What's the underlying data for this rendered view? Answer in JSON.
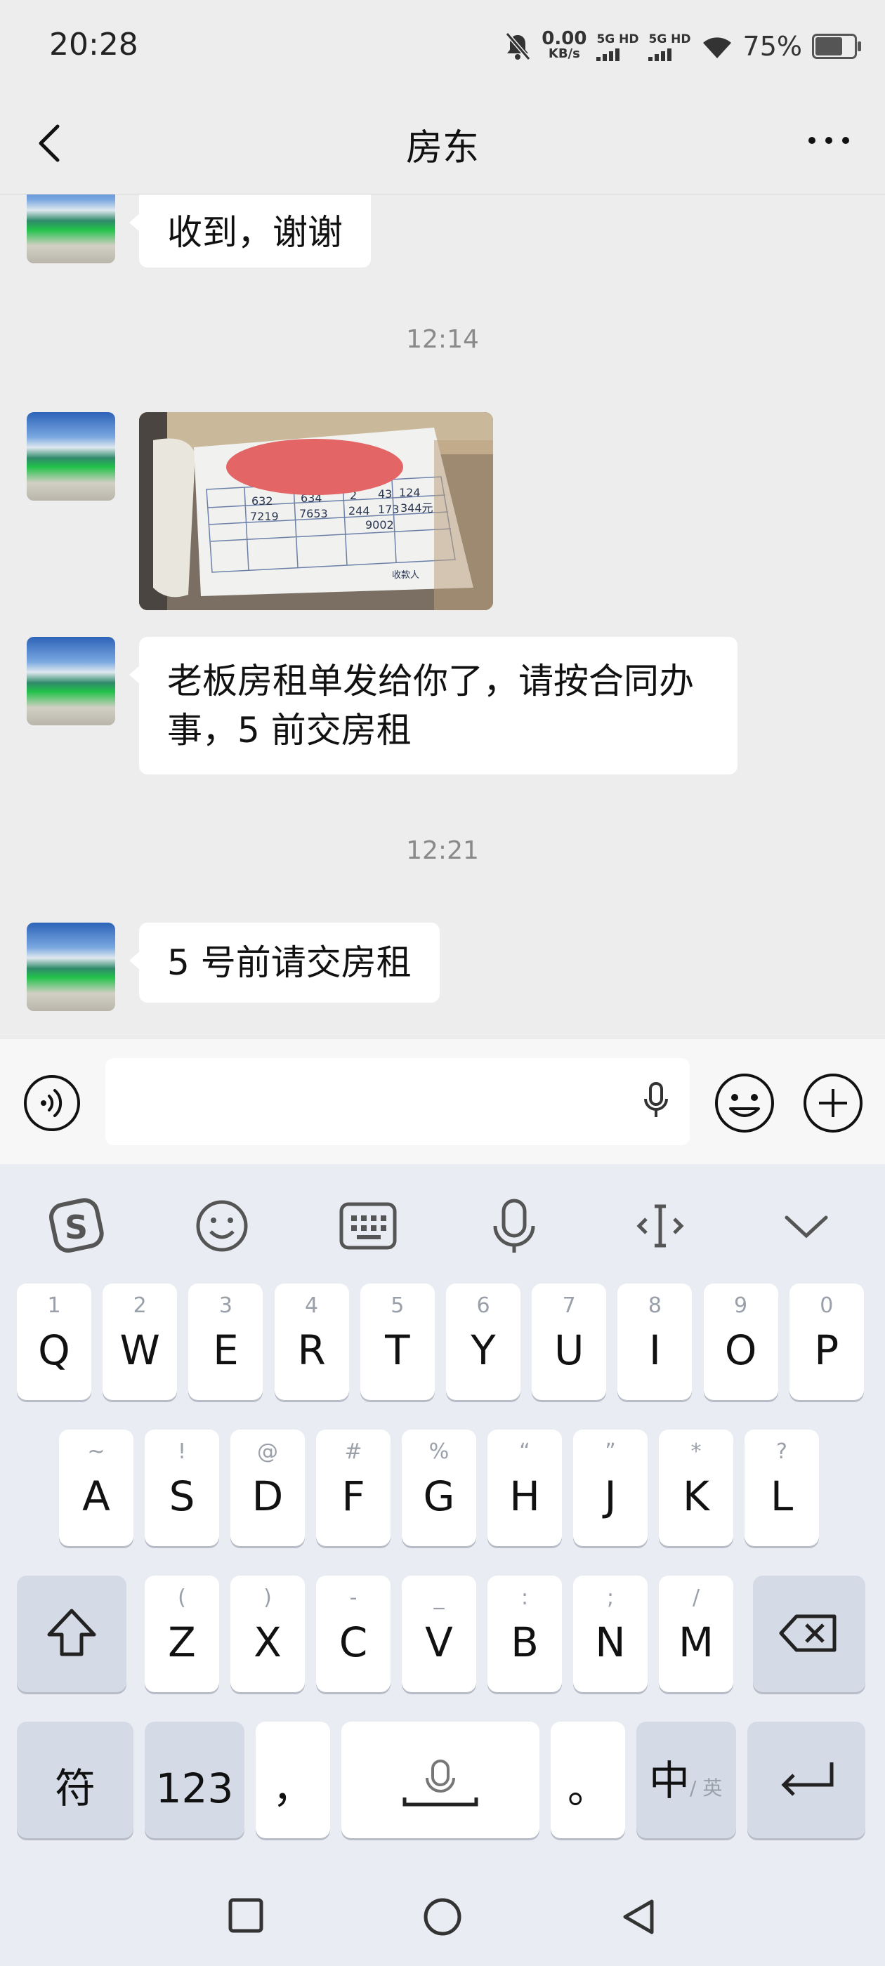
{
  "status_bar": {
    "time": "20:28",
    "net_speed_value": "0.00",
    "net_speed_unit": "KB/s",
    "sim1_label": "5G HD",
    "sim2_label": "5G HD",
    "battery_percent": "75%",
    "battery_level": 0.75,
    "icons": [
      "bell-muted-icon",
      "wifi-icon",
      "battery-icon"
    ]
  },
  "header": {
    "title": "房东"
  },
  "messages": {
    "m1_text": "收到，谢谢",
    "ts1": "12:14",
    "m3_line1": "老板房租单发给你了，请按合同办",
    "m3_line2": "事，5 前交房租",
    "ts2": "12:21",
    "m4_text": "5 号前请交房租"
  },
  "receipt": {
    "cells": [
      "632",
      "634",
      "2",
      "43",
      "124",
      "7219",
      "7653",
      "244",
      "173",
      "344元",
      "9002"
    ],
    "bottom": "收款人"
  },
  "input_bar": {
    "placeholder": ""
  },
  "keyboard": {
    "toolbar": [
      "sogou-logo-icon",
      "emoji-icon",
      "keyboard-icon",
      "mic-icon",
      "cursor-icon",
      "collapse-icon"
    ],
    "row1": [
      {
        "sub": "1",
        "main": "Q"
      },
      {
        "sub": "2",
        "main": "W"
      },
      {
        "sub": "3",
        "main": "E"
      },
      {
        "sub": "4",
        "main": "R"
      },
      {
        "sub": "5",
        "main": "T"
      },
      {
        "sub": "6",
        "main": "Y"
      },
      {
        "sub": "7",
        "main": "U"
      },
      {
        "sub": "8",
        "main": "I"
      },
      {
        "sub": "9",
        "main": "O"
      },
      {
        "sub": "0",
        "main": "P"
      }
    ],
    "row2": [
      {
        "sub": "~",
        "main": "A"
      },
      {
        "sub": "!",
        "main": "S"
      },
      {
        "sub": "@",
        "main": "D"
      },
      {
        "sub": "#",
        "main": "F"
      },
      {
        "sub": "%",
        "main": "G"
      },
      {
        "sub": "“",
        "main": "H"
      },
      {
        "sub": "”",
        "main": "J"
      },
      {
        "sub": "*",
        "main": "K"
      },
      {
        "sub": "?",
        "main": "L"
      }
    ],
    "row3": [
      {
        "sub": "(",
        "main": "Z"
      },
      {
        "sub": ")",
        "main": "X"
      },
      {
        "sub": "-",
        "main": "C"
      },
      {
        "sub": "_",
        "main": "V"
      },
      {
        "sub": ":",
        "main": "B"
      },
      {
        "sub": ";",
        "main": "N"
      },
      {
        "sub": "/",
        "main": "M"
      }
    ],
    "symbols_label": "符",
    "numbers_label": "123",
    "comma_label": "，",
    "period_label": "。",
    "lang_main": "中",
    "lang_sub": "/ 英"
  }
}
